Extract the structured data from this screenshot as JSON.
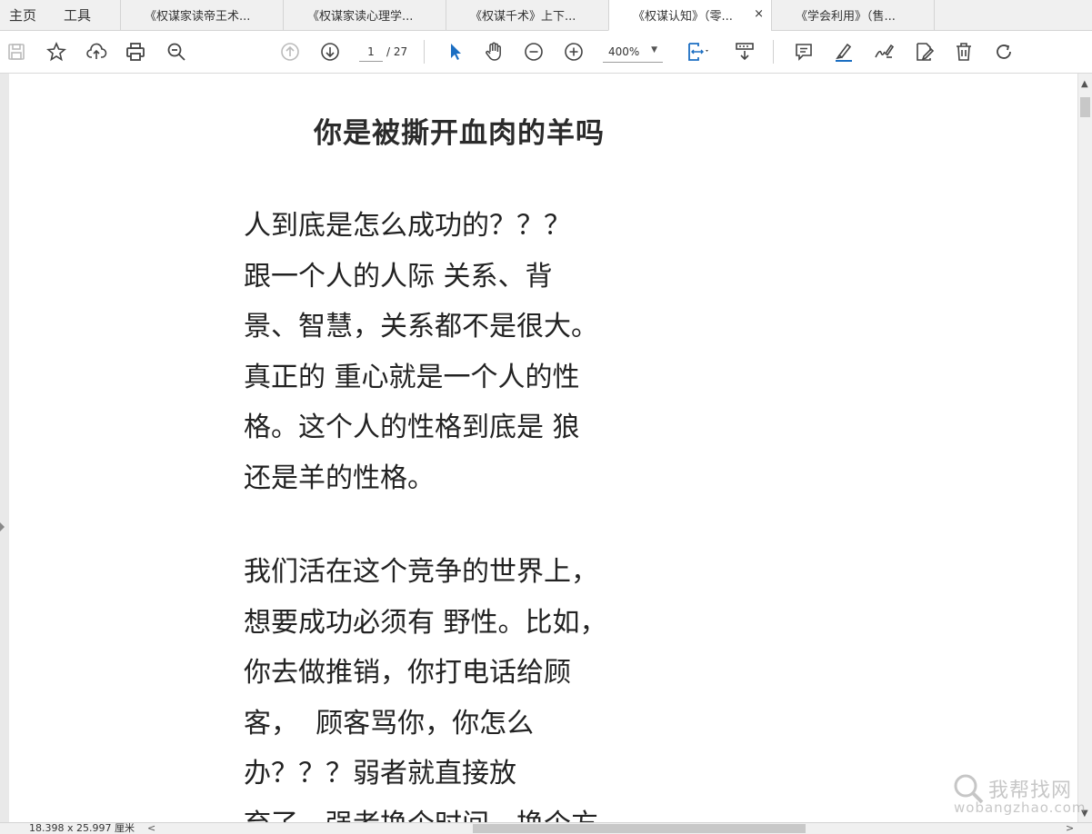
{
  "menu": {
    "home": "主页",
    "tools": "工具"
  },
  "tabs": [
    {
      "label": "《权谋家读帝王术..."
    },
    {
      "label": "《权谋家读心理学..."
    },
    {
      "label": "《权谋千术》上下..."
    },
    {
      "label": "《权谋认知》（零...",
      "active": true,
      "close": "×"
    },
    {
      "label": "《学会利用》（售..."
    }
  ],
  "toolbar": {
    "icons": [
      "save-icon",
      "star-icon",
      "upload-icon",
      "print-icon",
      "zoom-search-icon",
      "page-up-icon",
      "page-down-icon",
      "select-arrow-icon",
      "hand-icon",
      "zoom-out-icon",
      "zoom-in-icon",
      "fit-page-icon",
      "scroll-mode-icon",
      "comment-icon",
      "highlight-icon",
      "sign-icon",
      "edit-icon",
      "delete-icon",
      "rotate-icon"
    ],
    "page_current": "1",
    "page_total": "/ 27",
    "zoom": "400%",
    "accent": "#1b6ec2"
  },
  "document": {
    "title": "你是被撕开血肉的羊吗",
    "paragraphs": [
      {
        "lines": [
          "人到底是怎么成功的？？？",
          "跟一个人的人际 关系、背",
          "景、智慧，关系都不是很大。",
          "真正的 重心就是一个人的性",
          "格。这个人的性格到底是 狼",
          "还是羊的性格。"
        ]
      },
      {
        "lines": [
          "我们活在这个竞争的世界上，",
          "想要成功必须有 野性。比如，",
          "你去做推销，你打电话给顾",
          "客，  顾客骂你，你怎么",
          "办？？？弱者就直接放",
          "弃了，强者换个时间，换个方"
        ]
      }
    ]
  },
  "status": {
    "page_size": "18.398 x 25.997 厘米",
    "left_arrow": "<",
    "right_arrow": ">"
  },
  "watermark": {
    "cn": "我帮找网",
    "en": "wobangzhao.com"
  }
}
